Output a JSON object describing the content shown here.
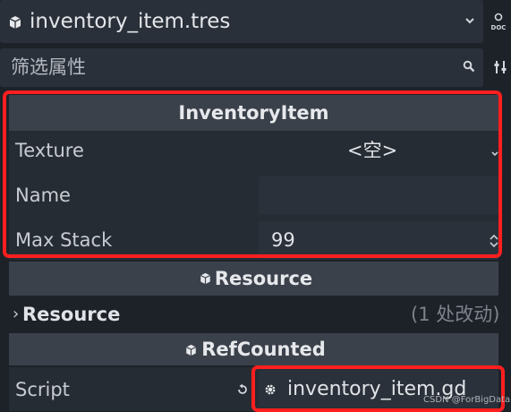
{
  "resource_bar": {
    "name": "inventory_item.tres",
    "doc_label": "DOC"
  },
  "filter": {
    "placeholder": "筛选属性"
  },
  "inventory_section": {
    "title": "InventoryItem",
    "rows": [
      {
        "label": "Texture",
        "value": "<空>"
      },
      {
        "label": "Name",
        "value": ""
      },
      {
        "label": "Max Stack",
        "value": "99"
      }
    ]
  },
  "resource_section": {
    "title": "Resource",
    "sub_label": "Resource",
    "changes": "(1 处改动)"
  },
  "refcounted_section": {
    "title": "RefCounted",
    "script_label": "Script",
    "script_value": "inventory_item.gd"
  },
  "watermark": "CSDN @ForBigData",
  "colors": {
    "highlight": "#ff1f1f",
    "panel": "#262c34",
    "header": "#3a414b"
  }
}
